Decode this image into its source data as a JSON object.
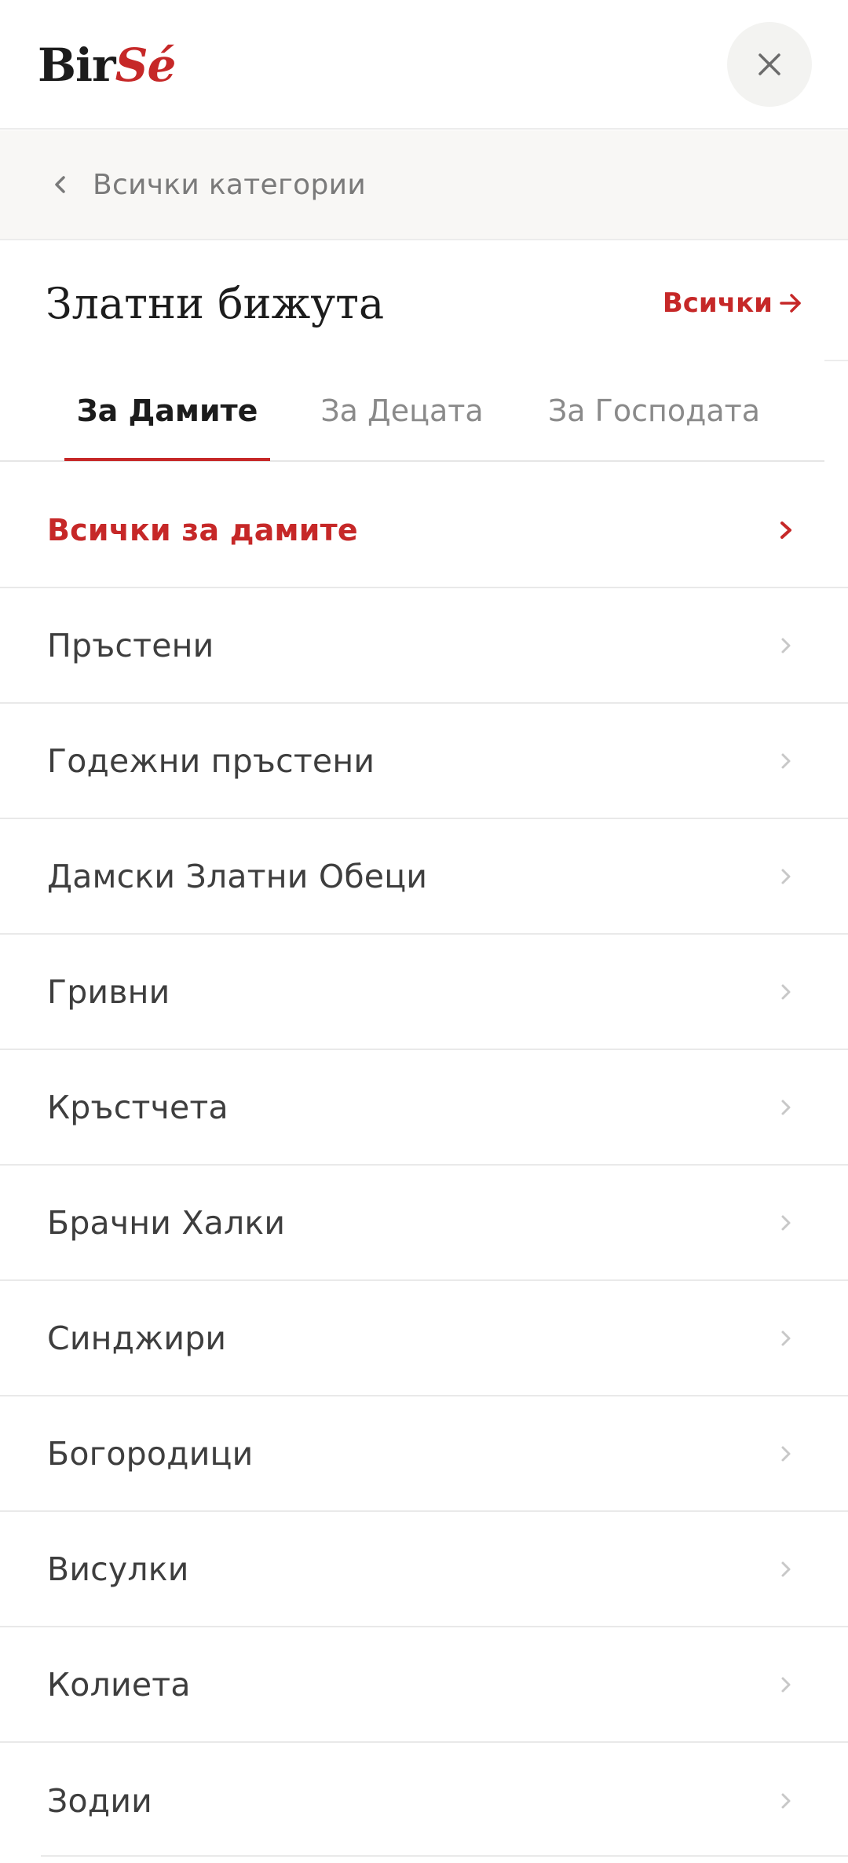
{
  "brand": {
    "logo_part1": "Bir",
    "logo_part2": "Sé",
    "accent_color": "#c62828"
  },
  "header": {
    "close_icon": "close-icon"
  },
  "back": {
    "label": "Всички категории",
    "icon": "chevron-left-icon"
  },
  "category": {
    "title": "Златни бижута",
    "see_all_label": "Всички"
  },
  "tabs": [
    {
      "label": "За Дамите",
      "active": true
    },
    {
      "label": "За Децата",
      "active": false
    },
    {
      "label": "За Господата",
      "active": false
    }
  ],
  "list": {
    "items": [
      {
        "label": "Всички за дамите",
        "highlight": true
      },
      {
        "label": "Пръстени"
      },
      {
        "label": "Годежни пръстени"
      },
      {
        "label": "Дамски Златни Обеци"
      },
      {
        "label": "Гривни"
      },
      {
        "label": "Кръстчета"
      },
      {
        "label": "Брачни Халки"
      },
      {
        "label": "Синджири"
      },
      {
        "label": "Богородици"
      },
      {
        "label": "Висулки"
      },
      {
        "label": "Колиета"
      },
      {
        "label": "Зодии"
      }
    ]
  }
}
